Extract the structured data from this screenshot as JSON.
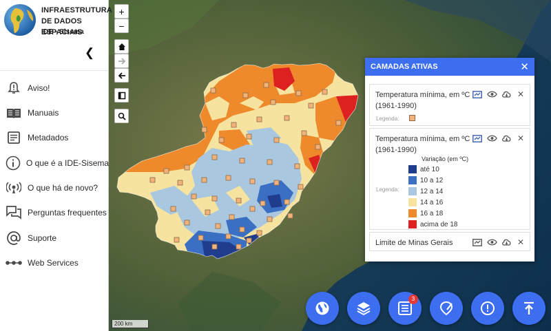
{
  "sidebar": {
    "logo_line1": "INFRAESTRUTURA",
    "logo_line2": "DE DADOS ESPACIAIS",
    "logo_line3": "IDE - Sisema",
    "collapse_glyph": "❮",
    "items": [
      {
        "label": "Aviso!",
        "icon": "bell-alert-icon"
      },
      {
        "label": "Manuais",
        "icon": "book-icon"
      },
      {
        "label": "Metadados",
        "icon": "document-icon"
      },
      {
        "label": "O que é a IDE-Sisema",
        "icon": "info-icon"
      },
      {
        "label": "O que há de novo?",
        "icon": "broadcast-icon"
      },
      {
        "label": "Perguntas frequentes",
        "icon": "chat-icon"
      },
      {
        "label": "Suporte",
        "icon": "at-sign-icon"
      },
      {
        "label": "Web Services",
        "icon": "network-icon"
      }
    ]
  },
  "map_controls": {
    "zoom_in": "+",
    "zoom_out": "−",
    "scale": "200 km"
  },
  "panel": {
    "title": "CAMADAS ATIVAS",
    "layers": [
      {
        "name": "Temperatura mínima, em ºC (1961-1990)",
        "legend_caption": "Legenda:"
      },
      {
        "name": "Temperatura mínima, em ºC (1961-1990)",
        "legend_caption": "Legenda:",
        "legend_title": "Variação (em ºC)"
      },
      {
        "name": "Limite de Minas Gerais"
      }
    ],
    "legend": [
      {
        "label": "até 10",
        "color": "#1f3d8c"
      },
      {
        "label": "10 a 12",
        "color": "#3a6fc4"
      },
      {
        "label": "12 a 14",
        "color": "#a9c8df"
      },
      {
        "label": "14 a 16",
        "color": "#f7e3a0"
      },
      {
        "label": "16 a 18",
        "color": "#ee8a2c"
      },
      {
        "label": "acima de 18",
        "color": "#dd2020"
      }
    ],
    "point_color": "#f2b27a"
  },
  "fab_badge": "3",
  "colors": {
    "accent": "#3d6ef0"
  }
}
